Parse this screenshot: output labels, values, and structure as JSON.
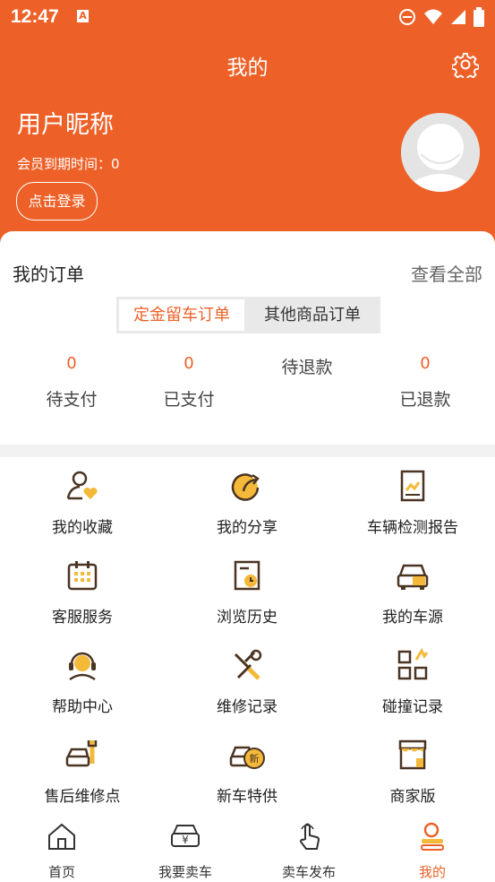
{
  "status_bar": {
    "time": "12:47",
    "badge": "A"
  },
  "header": {
    "title": "我的",
    "nickname": "用户昵称",
    "expire_label": "会员到期时间：0",
    "login_button": "点击登录"
  },
  "orders": {
    "heading": "我的订单",
    "view_all": "查看全部",
    "tabs": [
      "定金留车订单",
      "其他商品订单"
    ],
    "stats": [
      {
        "value": "0",
        "label": "待支付"
      },
      {
        "value": "0",
        "label": "已支付"
      },
      {
        "value": "",
        "label": "待退款"
      },
      {
        "value": "0",
        "label": "已退款"
      }
    ]
  },
  "menu": [
    {
      "label": "我的收藏",
      "icon": "favorite-user-icon"
    },
    {
      "label": "我的分享",
      "icon": "share-icon"
    },
    {
      "label": "车辆检测报告",
      "icon": "report-icon"
    },
    {
      "label": "客服服务",
      "icon": "calendar-icon"
    },
    {
      "label": "浏览历史",
      "icon": "history-icon"
    },
    {
      "label": "我的车源",
      "icon": "car-source-icon"
    },
    {
      "label": "帮助中心",
      "icon": "headset-icon"
    },
    {
      "label": "维修记录",
      "icon": "tools-icon"
    },
    {
      "label": "碰撞记录",
      "icon": "collision-icon"
    },
    {
      "label": "售后维修点",
      "icon": "repair-car-icon"
    },
    {
      "label": "新车特供",
      "icon": "new-car-icon"
    },
    {
      "label": "商家版",
      "icon": "store-icon"
    }
  ],
  "bottom_nav": [
    {
      "label": "首页",
      "icon": "home-icon"
    },
    {
      "label": "我要卖车",
      "icon": "sell-car-icon"
    },
    {
      "label": "卖车发布",
      "icon": "touch-icon"
    },
    {
      "label": "我的",
      "icon": "profile-icon",
      "active": true
    }
  ],
  "colors": {
    "accent": "#ed6128",
    "icon_yellow": "#f5b93a",
    "icon_dark": "#4a3422"
  }
}
